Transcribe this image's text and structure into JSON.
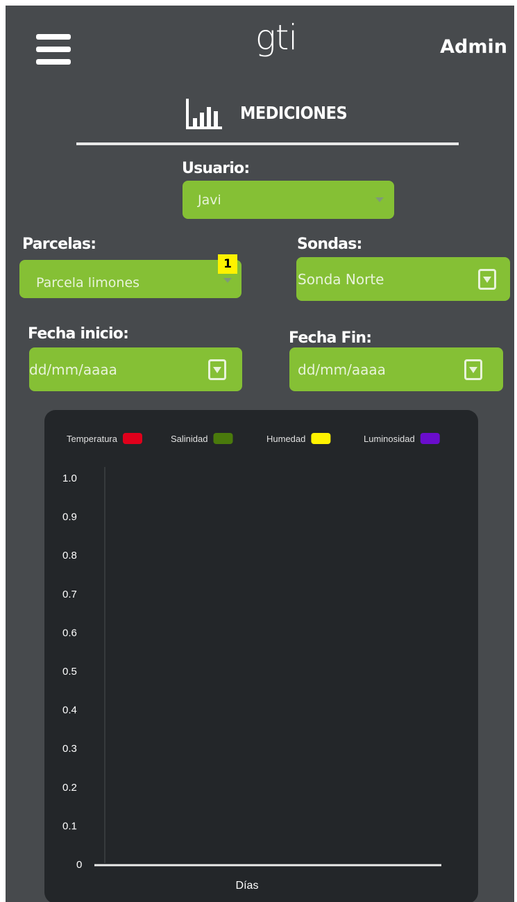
{
  "header": {
    "menu_icon": "hamburger-menu-icon",
    "logo_text": "gti",
    "user_label": "Admin"
  },
  "section": {
    "icon": "bar-chart-icon",
    "title": "MEDICIONES"
  },
  "form": {
    "usuario": {
      "label": "Usuario:",
      "value": "Javi"
    },
    "parcelas": {
      "label": "Parcelas:",
      "value": "Parcela limones",
      "badge": "1"
    },
    "sondas": {
      "label": "Sondas:",
      "value": "Sonda Norte"
    },
    "fecha_inicio": {
      "label": "Fecha inicio:",
      "placeholder": "dd/mm/aaaa"
    },
    "fecha_fin": {
      "label": "Fecha Fin:",
      "placeholder": "dd/mm/aaaa"
    }
  },
  "colors": {
    "background": "#474a4d",
    "accent": "#85c035",
    "chart_bg": "#232629",
    "badge": "#fef200"
  },
  "chart_data": {
    "type": "line",
    "legend": [
      {
        "name": "Temperatura",
        "color": "#e0001b"
      },
      {
        "name": "Salinidad",
        "color": "#4a7a0c"
      },
      {
        "name": "Humedad",
        "color": "#fff200"
      },
      {
        "name": "Luminosidad",
        "color": "#6a0dcc"
      }
    ],
    "series": [
      {
        "name": "Temperatura",
        "values": []
      },
      {
        "name": "Salinidad",
        "values": []
      },
      {
        "name": "Humedad",
        "values": []
      },
      {
        "name": "Luminosidad",
        "values": []
      }
    ],
    "y_ticks": [
      "1.0",
      "0.9",
      "0.8",
      "0.7",
      "0.6",
      "0.5",
      "0.4",
      "0.3",
      "0.2",
      "0.1",
      "0"
    ],
    "ylim": [
      0,
      1
    ],
    "xlabel": "Días",
    "ylabel": "",
    "legend_position": "top",
    "grid": false
  }
}
